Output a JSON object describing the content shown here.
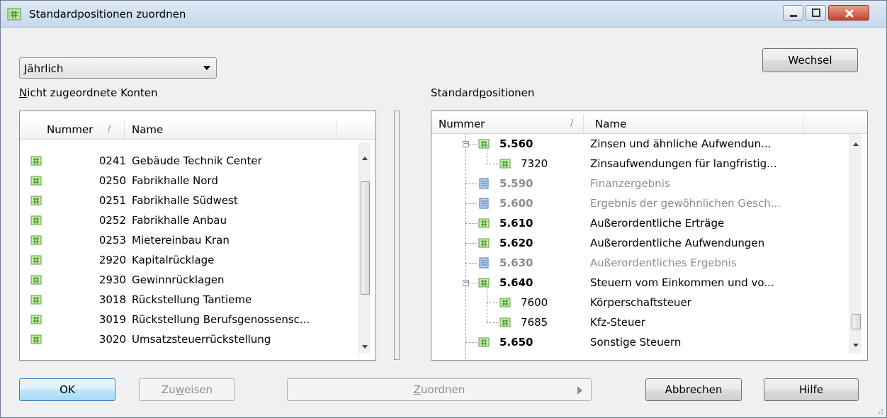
{
  "window": {
    "title": "Standardpositionen zuordnen"
  },
  "controls": {
    "period_select_value": "Jährlich",
    "wechsel_label": "Wechsel",
    "ok_label": "OK",
    "zuweisen_label_pre": "Zu",
    "zuweisen_label_u": "w",
    "zuweisen_label_post": "eisen",
    "zuordnen_label_u": "Z",
    "zuordnen_label_post": "uordnen",
    "abbrechen_label": "Abbrechen",
    "hilfe_label": "Hilfe"
  },
  "left": {
    "title_u": "N",
    "title_rest": "icht zugeordnete Konten",
    "columns": [
      "Nummer",
      "Name"
    ],
    "rows": [
      {
        "nummer": "0241",
        "name": "Gebäude Technik Center"
      },
      {
        "nummer": "0250",
        "name": "Fabrikhalle Nord"
      },
      {
        "nummer": "0251",
        "name": "Fabrikhalle Südwest"
      },
      {
        "nummer": "0252",
        "name": "Fabrikhalle Anbau"
      },
      {
        "nummer": "0253",
        "name": "Mietereinbau Kran"
      },
      {
        "nummer": "2920",
        "name": "Kapitalrücklage"
      },
      {
        "nummer": "2930",
        "name": "Gewinnrücklagen"
      },
      {
        "nummer": "3018",
        "name": "Rückstellung Tantieme"
      },
      {
        "nummer": "3019",
        "name": "Rückstellung Berufsgenossensc..."
      },
      {
        "nummer": "3020",
        "name": "Umsatzsteuerrückstellung"
      }
    ]
  },
  "right": {
    "title_pre": "Standard",
    "title_u": "p",
    "title_post": "ositionen",
    "columns": [
      "Nummer",
      "Name"
    ],
    "rows": [
      {
        "nummer": "5.560",
        "name": "Zinsen und ähnliche Aufwendun...",
        "kind": "pos",
        "level": 0,
        "expander": true
      },
      {
        "nummer": "7320",
        "name": "Zinsaufwendungen für langfristig...",
        "kind": "acc",
        "level": 1
      },
      {
        "nummer": "5.590",
        "name": "Finanzergebnis",
        "kind": "calc",
        "level": 0
      },
      {
        "nummer": "5.600",
        "name": "Ergebnis der gewöhnlichen Gesch...",
        "kind": "calc",
        "level": 0
      },
      {
        "nummer": "5.610",
        "name": "Außerordentliche Erträge",
        "kind": "pos",
        "level": 0
      },
      {
        "nummer": "5.620",
        "name": "Außerordentliche Aufwendungen",
        "kind": "pos",
        "level": 0
      },
      {
        "nummer": "5.630",
        "name": "Außerordentliches Ergebnis",
        "kind": "calc",
        "level": 0
      },
      {
        "nummer": "5.640",
        "name": "Steuern vom Einkommen und vo...",
        "kind": "pos",
        "level": 0,
        "expander": true
      },
      {
        "nummer": "7600",
        "name": "Körperschaftsteuer",
        "kind": "acc",
        "level": 1
      },
      {
        "nummer": "7685",
        "name": "Kfz-Steuer",
        "kind": "acc",
        "level": 1
      },
      {
        "nummer": "5.650",
        "name": "Sonstige Steuern",
        "kind": "pos",
        "level": 0
      }
    ]
  }
}
